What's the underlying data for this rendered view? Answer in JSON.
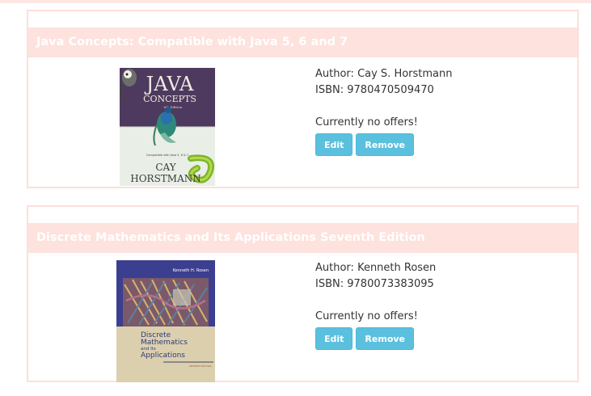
{
  "books": [
    {
      "title": "Java Concepts: Compatible with Java 5, 6 and 7",
      "author_label": "Author:",
      "author": "Cay S. Horstmann",
      "isbn_label": "ISBN:",
      "isbn": "9780470509470",
      "offers_text": "Currently no offers!",
      "edit_label": "Edit",
      "remove_label": "Remove",
      "cover": {
        "title_line1": "JAVA",
        "title_line2": "CONCEPTS",
        "edition": "6th Edition",
        "subtitle": "Compatible with Java 5, 6 & 7",
        "author_line1": "CAY",
        "author_line2": "HORSTMANN"
      }
    },
    {
      "title": "Discrete Mathematics and Its Applications Seventh Edition",
      "author_label": "Author:",
      "author": "Kenneth Rosen",
      "isbn_label": "ISBN:",
      "isbn": "9780073383095",
      "offers_text": "Currently no offers!",
      "edit_label": "Edit",
      "remove_label": "Remove",
      "cover": {
        "author_name": "Kenneth H. Rosen",
        "title_line1": "Discrete",
        "title_line2": "Mathematics",
        "title_line3": "and Its",
        "title_line4": "Applications",
        "edition": "SEVENTH EDITION"
      }
    }
  ]
}
